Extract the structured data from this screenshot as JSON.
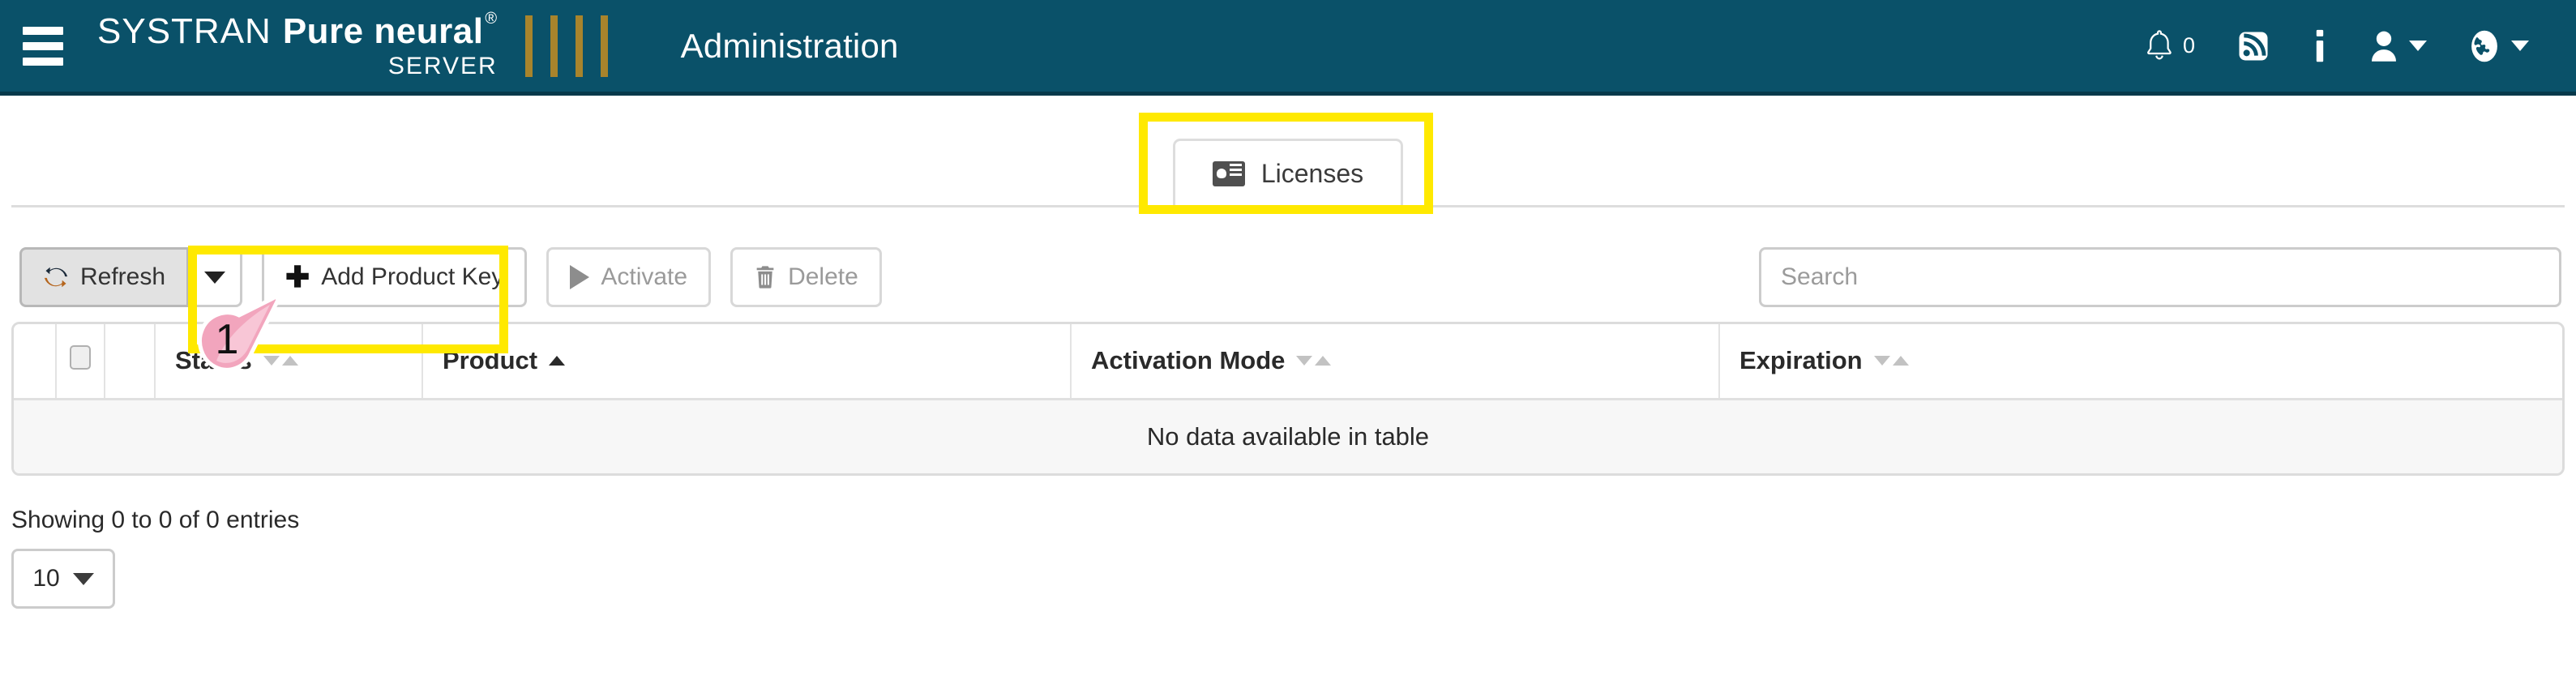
{
  "header": {
    "menu_icon": "hamburger-icon",
    "logo": {
      "systran": "SYSTRAN",
      "pure_neural": "Pure neural",
      "registered": "®",
      "server": "SERVER"
    },
    "app_title": "Administration",
    "notifications": {
      "icon": "bell-icon",
      "count": "0"
    },
    "feed": {
      "icon": "rss-feed-icon"
    },
    "info": {
      "icon": "info-icon"
    },
    "user": {
      "icon": "user-icon"
    },
    "language": {
      "icon": "globe-icon"
    }
  },
  "tabs": [
    {
      "label": "Licenses",
      "icon": "id-card-icon",
      "active": true
    }
  ],
  "toolbar": {
    "refresh_label": "Refresh",
    "refresh_icon": "refresh-icon",
    "refresh_dropdown_icon": "caret-down-icon",
    "add_product_key_label": "Add Product Key",
    "add_product_key_icon": "plus-icon",
    "activate_label": "Activate",
    "activate_icon": "play-icon",
    "delete_label": "Delete",
    "delete_icon": "trash-icon"
  },
  "search": {
    "placeholder": "Search",
    "value": ""
  },
  "table": {
    "columns": [
      {
        "label": "Status",
        "sort": "none"
      },
      {
        "label": "Product",
        "sort": "asc"
      },
      {
        "label": "Activation Mode",
        "sort": "none"
      },
      {
        "label": "Expiration",
        "sort": "none"
      }
    ],
    "empty_message": "No data available in table",
    "select_all_checkbox": false
  },
  "footer": {
    "entries_info": "Showing 0 to 0 of 0 entries",
    "page_length": "10"
  },
  "annotations": {
    "step_number": "1",
    "highlight_color": "#ffe900",
    "cursor_color": "#f2a5bd"
  },
  "colors": {
    "header_bg": "#0a5169",
    "header_border": "#06394b",
    "logo_bars": "#a8842c",
    "button_grey": "#e2e2e2",
    "table_empty_bg": "#f7f7f7"
  }
}
